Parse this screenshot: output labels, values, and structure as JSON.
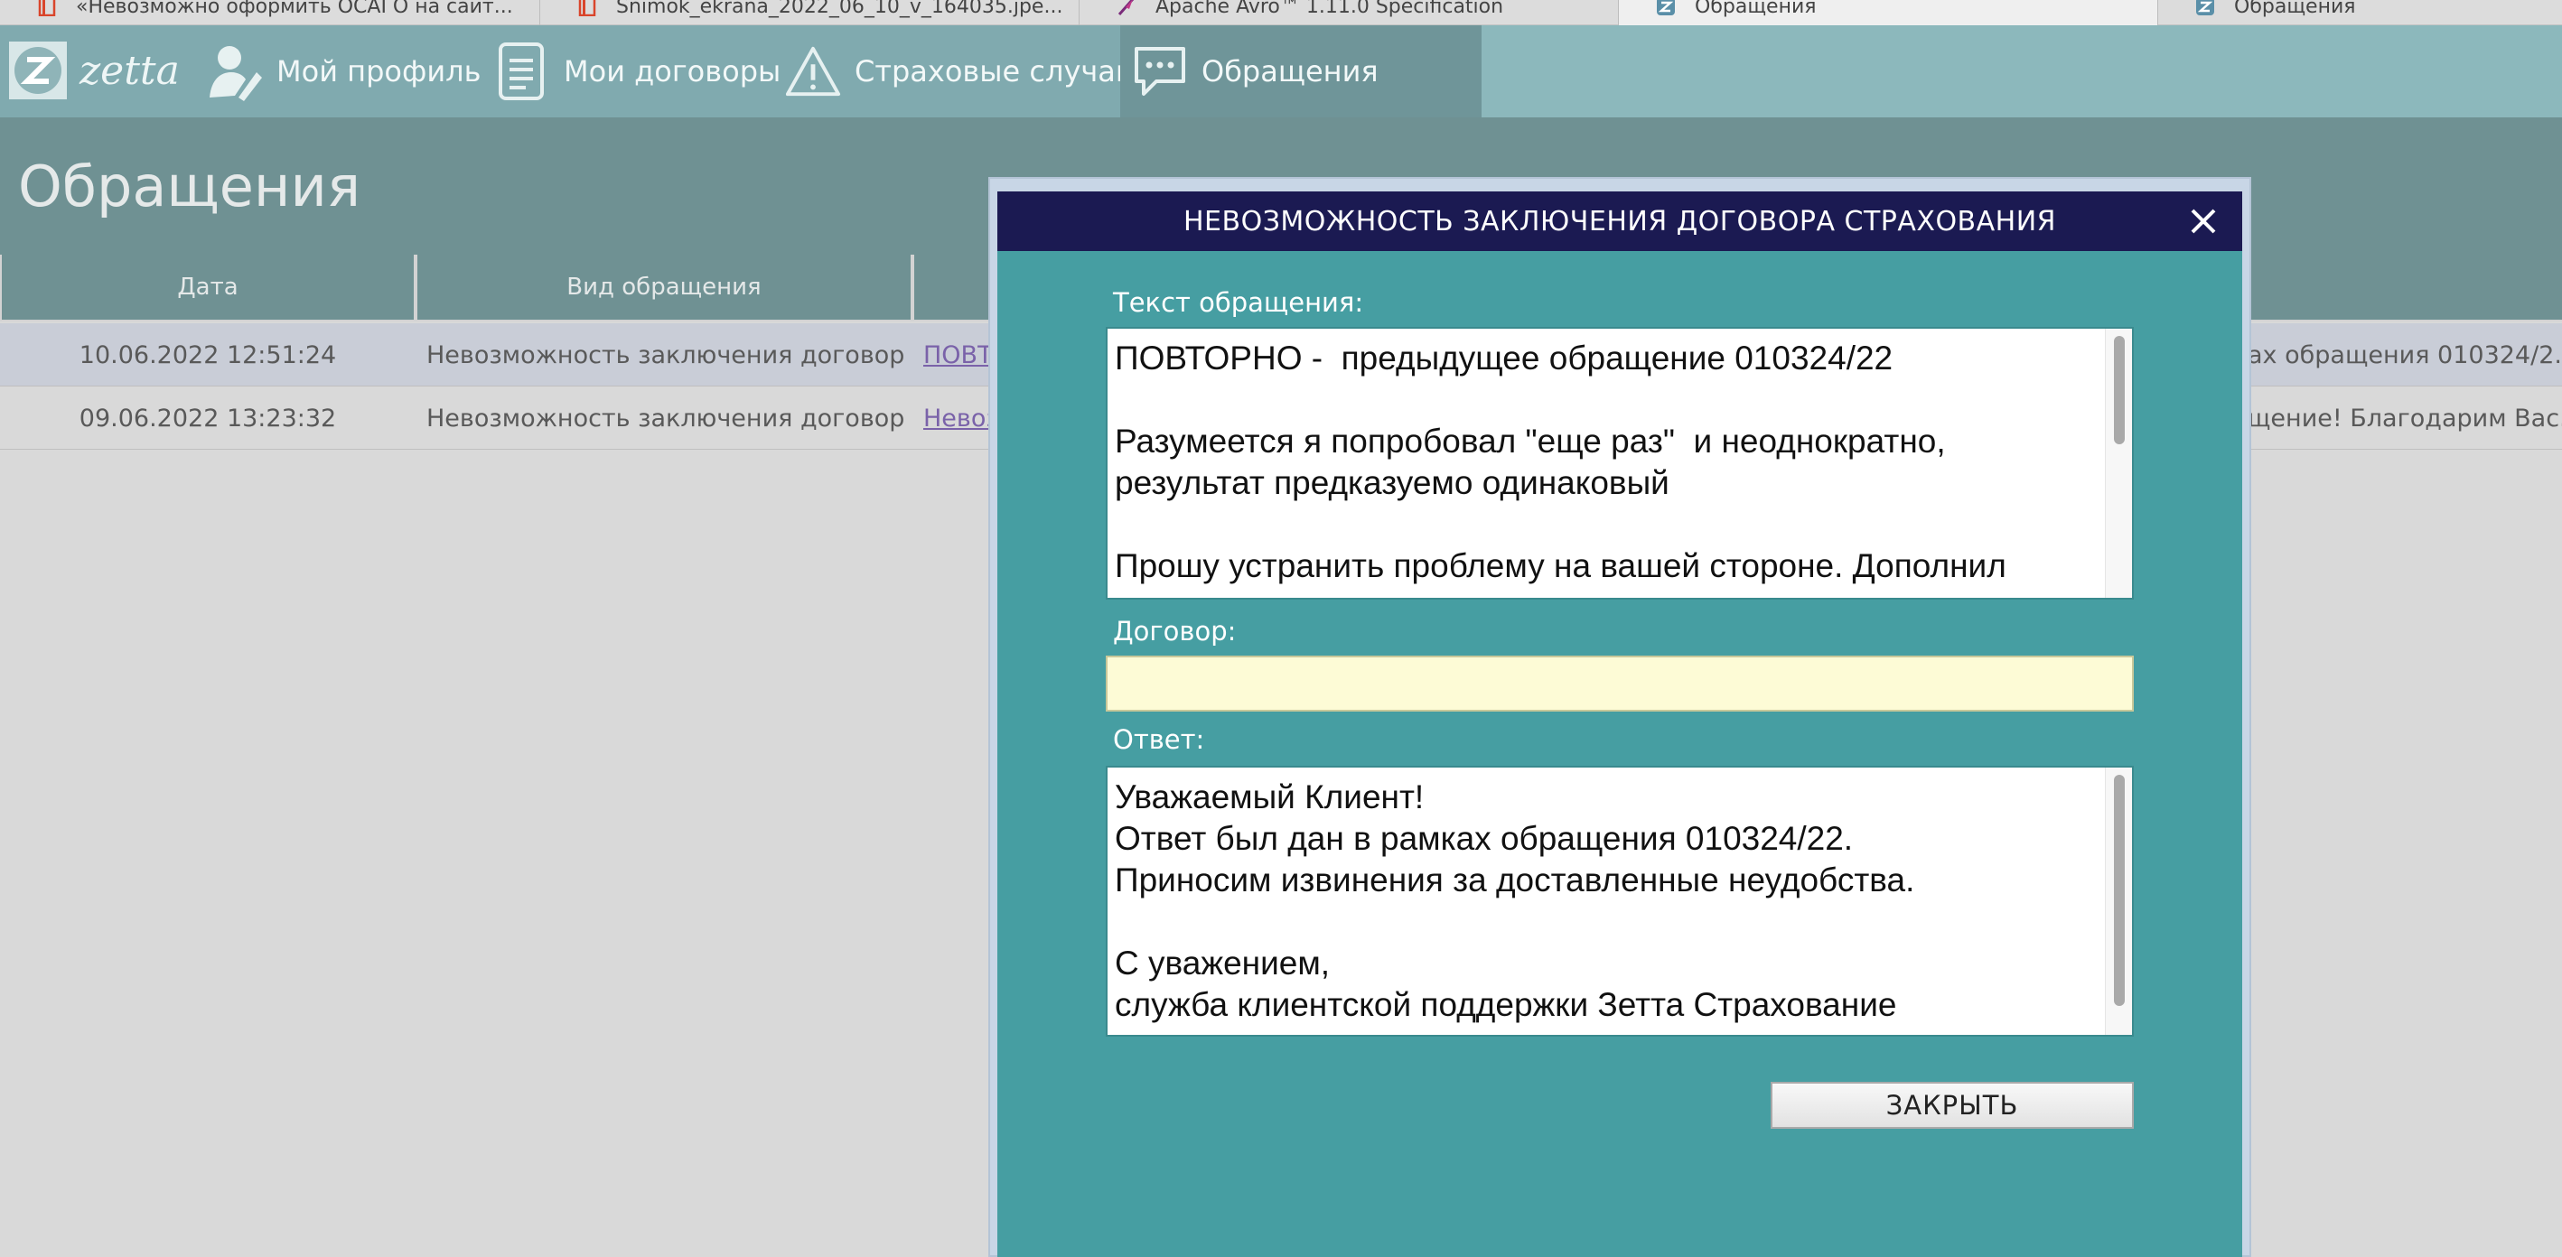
{
  "browser_tabs": [
    {
      "label": "«Невозможно оформить ОСАГО на сайт...",
      "icon": "doc-red-icon",
      "active": false
    },
    {
      "label": "Snimok_ekrana_2022_06_10_v_164035.jpe...",
      "icon": "doc-red-icon",
      "active": false
    },
    {
      "label": "Apache Avro™ 1.11.0 Specification",
      "icon": "feather-icon",
      "active": false
    },
    {
      "label": "Обращения",
      "icon": "zetta-favicon-icon",
      "active": true
    },
    {
      "label": "Обращения",
      "icon": "zetta-favicon-icon",
      "active": false
    }
  ],
  "nav": {
    "logo_text": "zetta",
    "items": [
      {
        "label": "Мой профиль",
        "icon": "profile-icon"
      },
      {
        "label": "Мои договоры",
        "icon": "document-icon"
      },
      {
        "label": "Страховые случаи",
        "icon": "warning-icon"
      },
      {
        "label": "Обращения",
        "icon": "chat-icon",
        "active": true
      }
    ]
  },
  "page": {
    "title": "Обращения"
  },
  "table": {
    "headers": [
      "Дата",
      "Вид обращения"
    ],
    "rows": [
      {
        "date": "10.06.2022 12:51:24",
        "type": "Невозможность заключения договора ...",
        "subject": "ПОВТ",
        "answer": "ах обращения 010324/2..."
      },
      {
        "date": "09.06.2022 13:23:32",
        "type": "Невозможность заключения договора ...",
        "subject": "Невоз",
        "answer": "щение! Благодарим Вас..."
      }
    ]
  },
  "dialog": {
    "title": "НЕВОЗМОЖНОСТЬ ЗАКЛЮЧЕНИЯ ДОГОВОРА СТРАХОВАНИЯ",
    "request_label": "Текст обращения:",
    "request_text": "ПОВТОРНО -  предыдущее обращение 010324/22\n\nРазумеется я попробовал \"еще раз\"  и неоднократно,\nрезультат предказуемо одинаковый\n\nПрошу устранить проблему на вашей стороне. Дополнил",
    "contract_label": "Договор:",
    "contract_value": "",
    "answer_label": "Ответ:",
    "answer_text": "Уважаемый Клиент!\nОтвет был дан в рамках обращения 010324/22.\nПриносим извинения за доставленные неудобства.\n\nС уважением,\nслужба клиентской поддержки Зетта Страхование",
    "close_button": "ЗАКРЫТЬ"
  },
  "colors": {
    "nav_bg": "#80aaaf",
    "header_bg": "#6e9497",
    "dialog_bg": "#469ea2",
    "dialog_title_bg": "#1b1a52",
    "contract_input_bg": "#fdfbd6"
  }
}
